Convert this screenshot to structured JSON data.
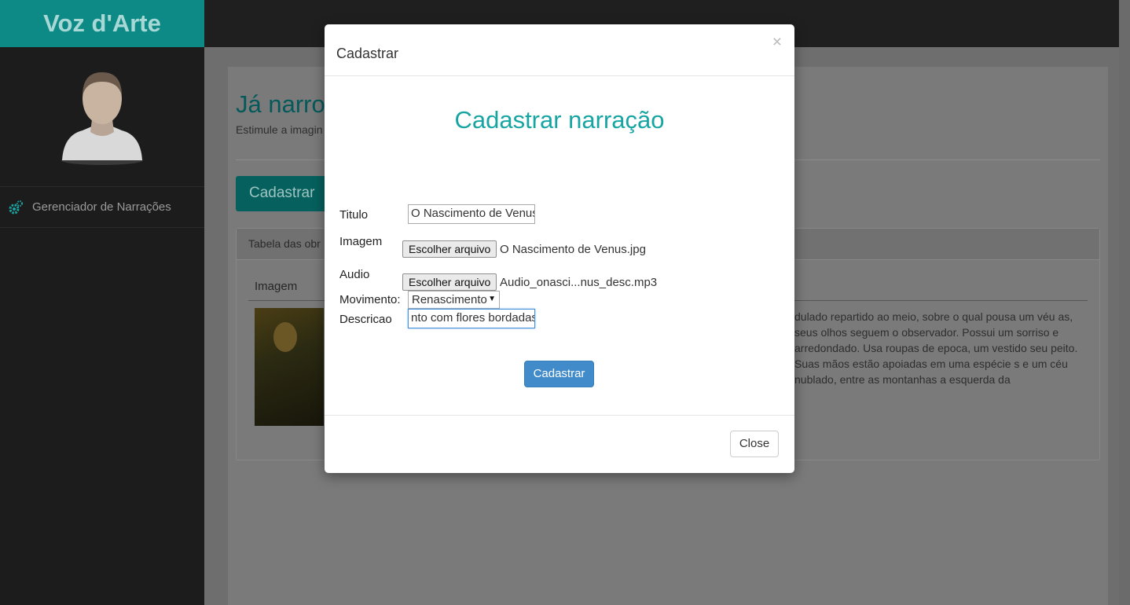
{
  "sidebar": {
    "brand": "Voz d'Arte",
    "nav_items": [
      {
        "label": "Gerenciador de Narrações",
        "icon": "gears-icon"
      }
    ]
  },
  "background": {
    "page_title": "Já narro",
    "page_subtitle": "Estimule a imagin",
    "cadastrar_button": "Cadastrar",
    "card_header": "Tabela das obr",
    "column_imagem": "Imagem",
    "description_text": "dulado repartido ao meio, sobre o qual pousa um véu as, seus olhos seguem o observador. Possui um sorriso e arredondado. Usa roupas de epoca, um vestido seu peito. Suas mãos estão apoiadas em uma espécie s e um céu nublado, entre as montanhas a esquerda da"
  },
  "modal": {
    "title": "Cadastrar",
    "close_symbol": "×",
    "heading": "Cadastrar narração",
    "fields": {
      "titulo_label": "Titulo",
      "titulo_value": "O Nascimento de Venus",
      "imagem_label": "Imagem",
      "imagem_button": "Escolher arquivo",
      "imagem_file": "O Nascimento de Venus.jpg",
      "audio_label": "Audio",
      "audio_button": "Escolher arquivo",
      "audio_file": "Audio_onasci...nus_desc.mp3",
      "movimento_label": "Movimento:",
      "movimento_value": "Renascimento",
      "descricao_label": "Descricao",
      "descricao_value": "nto com flores bordadas."
    },
    "submit_button": "Cadastrar",
    "footer_close_button": "Close"
  },
  "colors": {
    "brand": "#0e8a86",
    "heading": "#17a5a3",
    "primary": "#428bca"
  }
}
